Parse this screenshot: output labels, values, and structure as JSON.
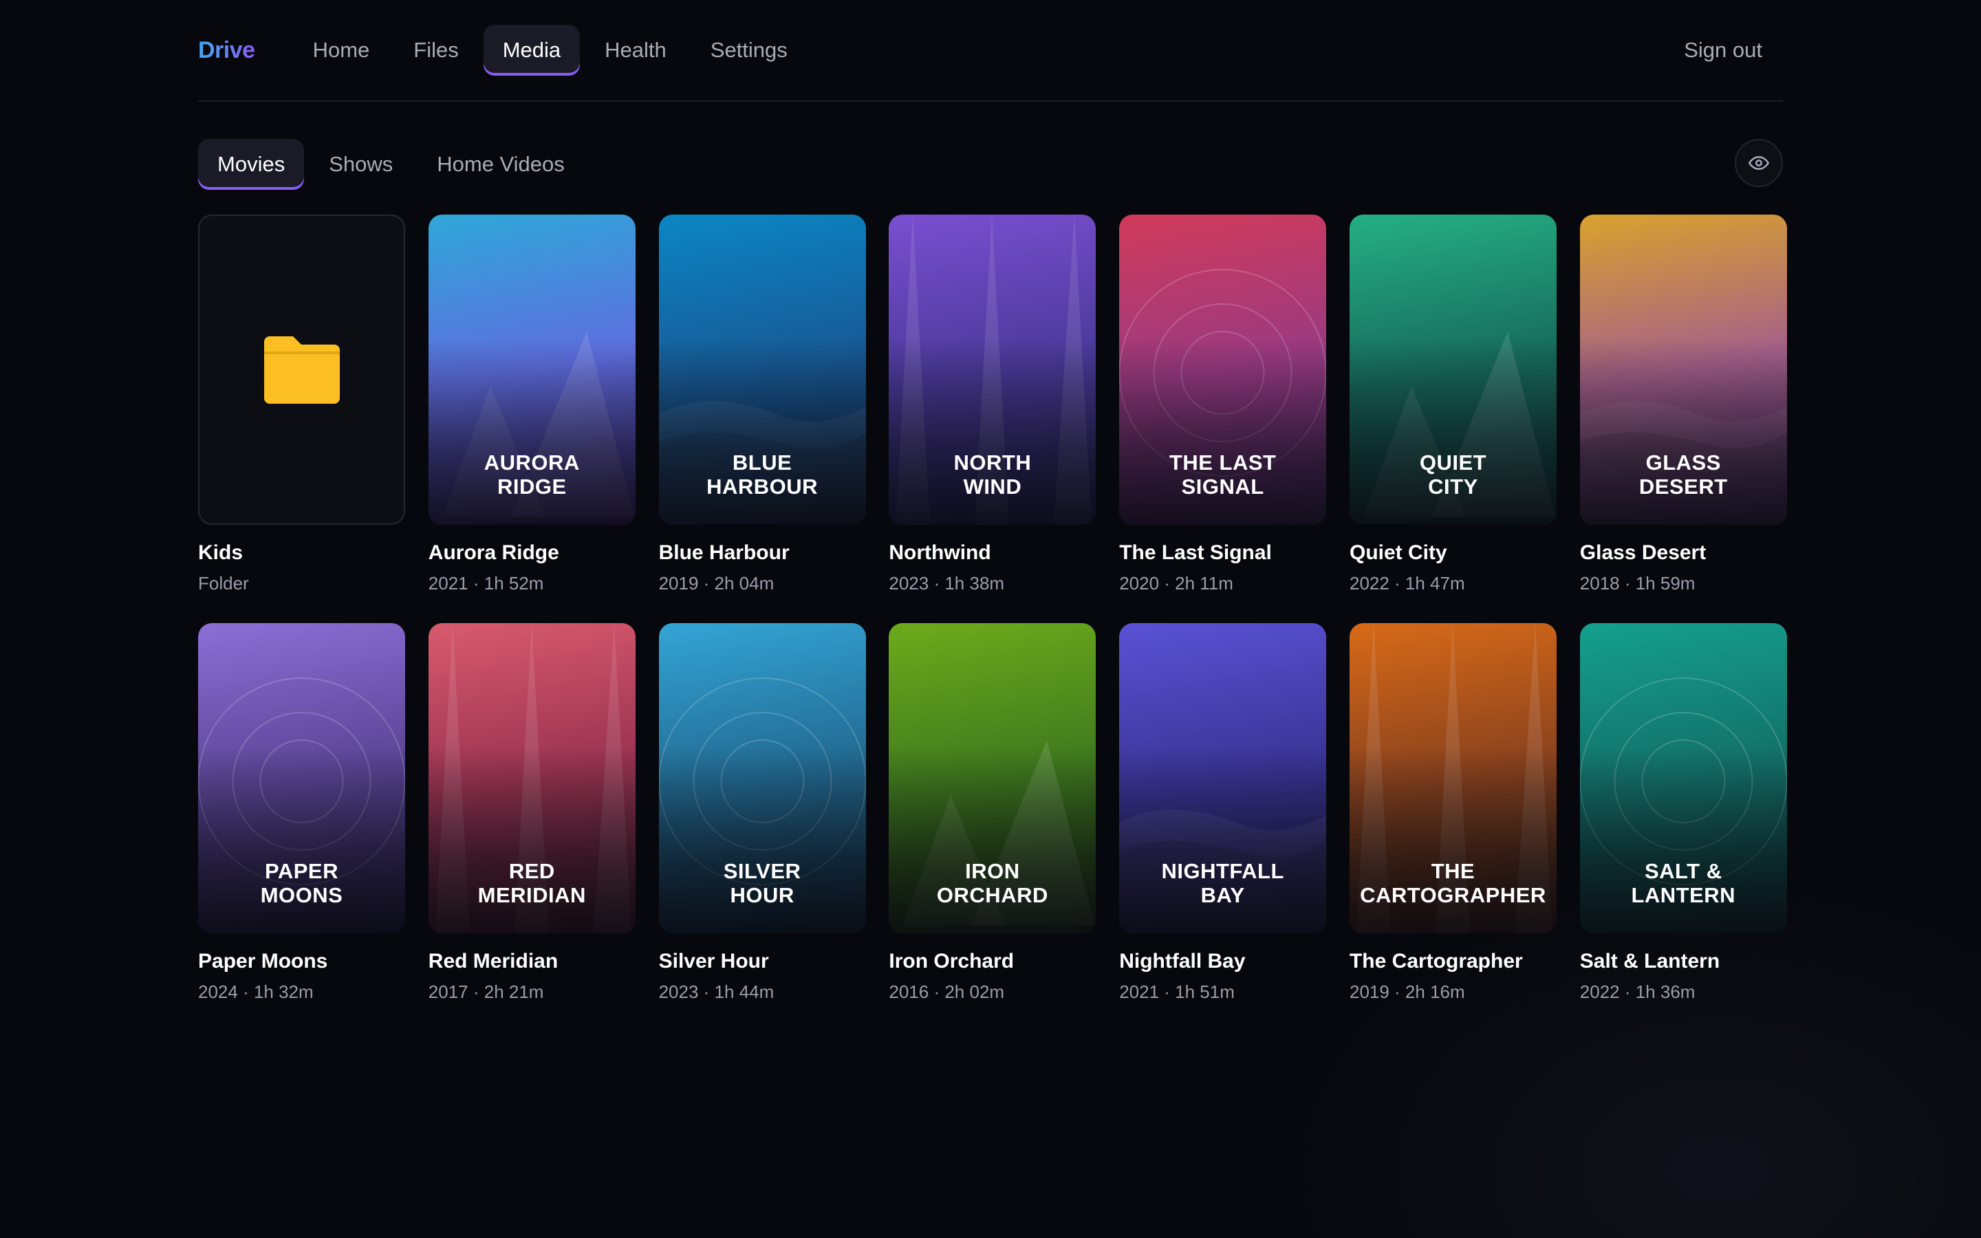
{
  "app": {
    "brand": "Drive"
  },
  "nav": {
    "items": [
      {
        "label": "Home",
        "active": false
      },
      {
        "label": "Files",
        "active": false
      },
      {
        "label": "Media",
        "active": true
      },
      {
        "label": "Health",
        "active": false
      },
      {
        "label": "Settings",
        "active": false
      }
    ],
    "signout_label": "Sign out"
  },
  "subtabs": [
    {
      "label": "Movies",
      "active": true
    },
    {
      "label": "Shows",
      "active": false
    },
    {
      "label": "Home Videos",
      "active": false
    }
  ],
  "toolbar": {
    "view_icon": "eye-icon"
  },
  "folder": {
    "name": "Kids",
    "meta": "Folder",
    "icon": "folder-icon",
    "color": "#fbbf24"
  },
  "movies": [
    {
      "title": "Aurora Ridge",
      "poster": [
        "AURORA",
        "RIDGE"
      ],
      "meta": "2021 · 1h 52m",
      "motif": "mountains",
      "colors": [
        "#2ea7d8",
        "#5f6ee0",
        "#4a2c8c"
      ]
    },
    {
      "title": "Blue Harbour",
      "poster": [
        "BLUE",
        "HARBOUR"
      ],
      "meta": "2019 · 2h 04m",
      "motif": "waves",
      "colors": [
        "#0b86c4",
        "#175a96",
        "#142a54"
      ]
    },
    {
      "title": "Northwind",
      "poster": [
        "NORTH",
        "WIND"
      ],
      "meta": "2023 · 1h 38m",
      "motif": "beams",
      "colors": [
        "#7a4fd1",
        "#4b3a9b",
        "#2a2460"
      ]
    },
    {
      "title": "The Last Signal",
      "poster": [
        "THE LAST",
        "SIGNAL"
      ],
      "meta": "2020 · 2h 11m",
      "motif": "rings",
      "colors": [
        "#d13a5a",
        "#9a3a82",
        "#4a2c6a"
      ]
    },
    {
      "title": "Quiet City",
      "poster": [
        "QUIET",
        "CITY"
      ],
      "meta": "2022 · 1h 47m",
      "motif": "mountains",
      "colors": [
        "#25b083",
        "#176c5c",
        "#0f3a3a"
      ]
    },
    {
      "title": "Glass Desert",
      "poster": [
        "GLASS",
        "DESERT"
      ],
      "meta": "2018 · 1h 59m",
      "motif": "waves",
      "colors": [
        "#d9a22c",
        "#a5608a",
        "#4a2a6a"
      ]
    },
    {
      "title": "Paper Moons",
      "poster": [
        "PAPER",
        "MOONS"
      ],
      "meta": "2024 · 1h 32m",
      "motif": "rings",
      "colors": [
        "#8c6fd6",
        "#5a4596",
        "#2a2450"
      ]
    },
    {
      "title": "Red Meridian",
      "poster": [
        "RED",
        "MERIDIAN"
      ],
      "meta": "2017 · 2h 21m",
      "motif": "beams",
      "colors": [
        "#d95a6e",
        "#9a3352",
        "#4a1e30"
      ]
    },
    {
      "title": "Silver Hour",
      "poster": [
        "SILVER",
        "HOUR"
      ],
      "meta": "2023 · 1h 44m",
      "motif": "rings",
      "colors": [
        "#33a5d6",
        "#226a92",
        "#143048"
      ]
    },
    {
      "title": "Iron Orchard",
      "poster": [
        "IRON",
        "ORCHARD"
      ],
      "meta": "2016 · 2h 02m",
      "motif": "mountains",
      "colors": [
        "#6dab1b",
        "#3f7a1e",
        "#1e3a14"
      ]
    },
    {
      "title": "Nightfall Bay",
      "poster": [
        "NIGHTFALL",
        "BAY"
      ],
      "meta": "2021 · 1h 51m",
      "motif": "waves",
      "colors": [
        "#5a52d6",
        "#3a3496",
        "#1e1c50"
      ]
    },
    {
      "title": "The Cartographer",
      "poster": [
        "THE",
        "CARTOGRAPHER"
      ],
      "meta": "2019 · 2h 16m",
      "motif": "beams",
      "colors": [
        "#d86a18",
        "#8a421e",
        "#3e2216"
      ]
    },
    {
      "title": "Salt & Lantern",
      "poster": [
        "SALT &",
        "LANTERN"
      ],
      "meta": "2022 · 1h 36m",
      "motif": "rings",
      "colors": [
        "#14a08e",
        "#137068",
        "#0e3a3a"
      ]
    }
  ]
}
